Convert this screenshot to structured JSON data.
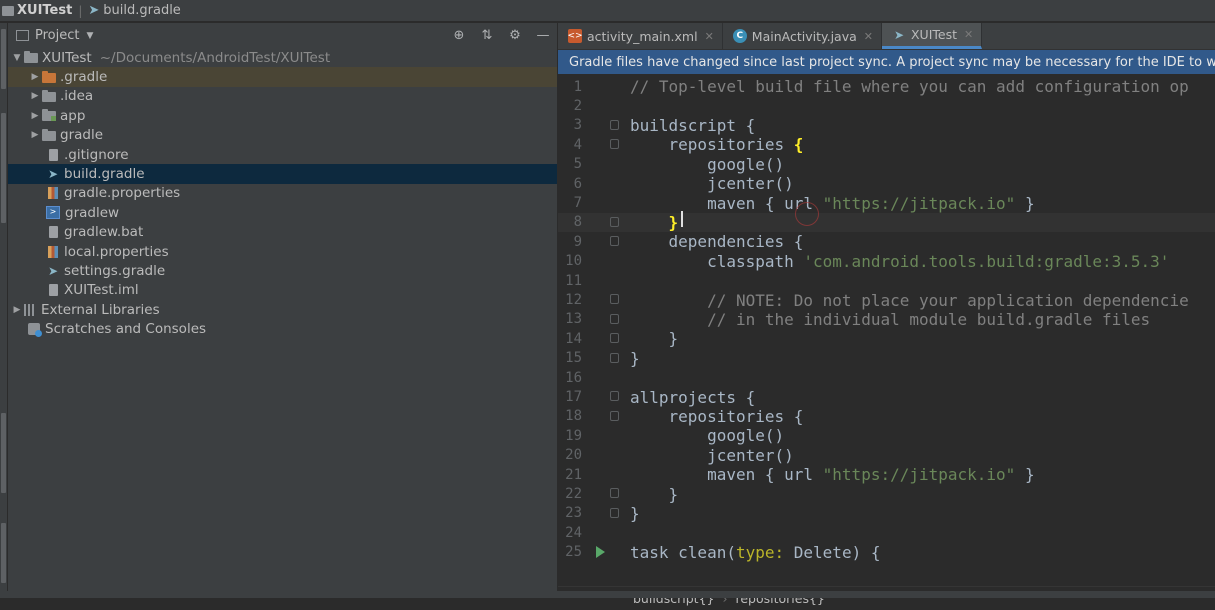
{
  "navbar": {
    "project": "XUITest",
    "file": "build.gradle"
  },
  "project_panel": {
    "view_label": "Project",
    "tree": [
      {
        "label": "XUITest",
        "path": "~/Documents/AndroidTest/XUITest",
        "icon": "module-folder-icon",
        "expanded": true
      },
      {
        "label": ".gradle",
        "icon": "folder-icon-orange",
        "collapsed": true
      },
      {
        "label": ".idea",
        "icon": "folder-icon",
        "collapsed": true
      },
      {
        "label": "app",
        "icon": "app-module-icon",
        "collapsed": true
      },
      {
        "label": "gradle",
        "icon": "folder-icon",
        "collapsed": true
      },
      {
        "label": ".gitignore",
        "icon": "text-file-icon"
      },
      {
        "label": "build.gradle",
        "icon": "gradle-icon",
        "selected": true
      },
      {
        "label": "gradle.properties",
        "icon": "properties-file-icon"
      },
      {
        "label": "gradlew",
        "icon": "shell-script-icon"
      },
      {
        "label": "gradlew.bat",
        "icon": "text-file-icon"
      },
      {
        "label": "local.properties",
        "icon": "properties-file-icon"
      },
      {
        "label": "settings.gradle",
        "icon": "gradle-icon"
      },
      {
        "label": "XUITest.iml",
        "icon": "text-file-icon"
      },
      {
        "label": "External Libraries",
        "icon": "library-icon",
        "collapsed": true
      },
      {
        "label": "Scratches and Consoles",
        "icon": "scratch-icon"
      }
    ]
  },
  "editor": {
    "tabs": [
      {
        "label": "activity_main.xml",
        "icon": "xml-file-icon"
      },
      {
        "label": "MainActivity.java",
        "icon": "java-class-icon"
      },
      {
        "label": "XUITest",
        "icon": "gradle-icon",
        "active": true
      }
    ],
    "banner": "Gradle files have changed since last project sync. A project sync may be necessary for the IDE to wor",
    "lines": [
      {
        "n": "1",
        "text": "// Top-level build file where you can add configuration op"
      },
      {
        "n": "2",
        "text": ""
      },
      {
        "n": "3",
        "text": "buildscript {"
      },
      {
        "n": "4",
        "text": "    repositories {"
      },
      {
        "n": "5",
        "text": "        google()"
      },
      {
        "n": "6",
        "text": "        jcenter()"
      },
      {
        "n": "7",
        "text": "        maven { url \"https://jitpack.io\" }"
      },
      {
        "n": "8",
        "text": "    }"
      },
      {
        "n": "9",
        "text": "    dependencies {"
      },
      {
        "n": "10",
        "text": "        classpath 'com.android.tools.build:gradle:3.5.3'"
      },
      {
        "n": "11",
        "text": ""
      },
      {
        "n": "12",
        "text": "        // NOTE: Do not place your application dependencie"
      },
      {
        "n": "13",
        "text": "        // in the individual module build.gradle files"
      },
      {
        "n": "14",
        "text": "    }"
      },
      {
        "n": "15",
        "text": "}"
      },
      {
        "n": "16",
        "text": ""
      },
      {
        "n": "17",
        "text": "allprojects {"
      },
      {
        "n": "18",
        "text": "    repositories {"
      },
      {
        "n": "19",
        "text": "        google()"
      },
      {
        "n": "20",
        "text": "        jcenter()"
      },
      {
        "n": "21",
        "text": "        maven { url \"https://jitpack.io\" }"
      },
      {
        "n": "22",
        "text": "    }"
      },
      {
        "n": "23",
        "text": "}"
      },
      {
        "n": "24",
        "text": ""
      },
      {
        "n": "25",
        "text": "task clean(type: Delete) {"
      }
    ],
    "breadcrumb": [
      "buildscript{}",
      "repositories{}"
    ]
  }
}
